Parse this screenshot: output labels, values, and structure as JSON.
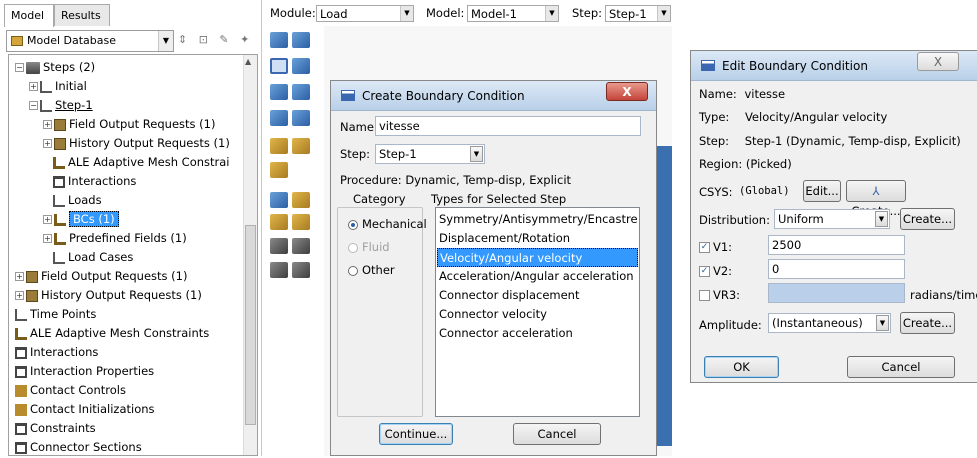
{
  "left_panel": {
    "tabs": [
      "Model",
      "Results"
    ],
    "database_selector": "Model Database",
    "tree": [
      {
        "label": "Steps (2)",
        "expander": "⊟",
        "icon": "steps"
      },
      {
        "label": "Initial",
        "expander": "⊞",
        "icon": "step"
      },
      {
        "label": "Step-1",
        "expander": "⊟",
        "icon": "step"
      },
      {
        "label": "Field Output Requests (1)",
        "expander": "⊞",
        "icon": "output"
      },
      {
        "label": "History Output Requests (1)",
        "expander": "⊞",
        "icon": "output"
      },
      {
        "label": "ALE Adaptive Mesh Constrai",
        "expander": "",
        "icon": "ale"
      },
      {
        "label": "Interactions",
        "expander": "",
        "icon": "interactions"
      },
      {
        "label": "Loads",
        "expander": "",
        "icon": "load"
      },
      {
        "label": "BCs (1)",
        "expander": "⊞",
        "icon": "bc"
      },
      {
        "label": "Predefined Fields (1)",
        "expander": "⊞",
        "icon": "bc"
      },
      {
        "label": "Load Cases",
        "expander": "",
        "icon": "load"
      },
      {
        "label": "Field Output Requests (1)",
        "expander": "⊞",
        "icon": "output"
      },
      {
        "label": "History Output Requests (1)",
        "expander": "⊞",
        "icon": "output"
      },
      {
        "label": "Time Points",
        "expander": "",
        "icon": "time"
      },
      {
        "label": "ALE Adaptive Mesh Constraints",
        "expander": "",
        "icon": "ale"
      },
      {
        "label": "Interactions",
        "expander": "",
        "icon": "interactions"
      },
      {
        "label": "Interaction Properties",
        "expander": "",
        "icon": "interactions"
      },
      {
        "label": "Contact Controls",
        "expander": "",
        "icon": "contact"
      },
      {
        "label": "Contact Initializations",
        "expander": "",
        "icon": "contact"
      },
      {
        "label": "Constraints",
        "expander": "",
        "icon": "constraint"
      },
      {
        "label": "Connector Sections",
        "expander": "",
        "icon": "connector"
      }
    ]
  },
  "toolbar": {
    "module_label": "Module:",
    "module_value": "Load",
    "model_label": "Model:",
    "model_value": "Model-1",
    "step_label": "Step:",
    "step_value": "Step-1"
  },
  "create_bc_dialog": {
    "title": "Create Boundary Condition",
    "name_label": "Name:",
    "name_value": "vitesse",
    "step_label": "Step:",
    "step_value": "Step-1",
    "procedure_label": "Procedure:",
    "procedure_value": "Dynamic, Temp-disp, Explicit",
    "category_label": "Category",
    "categories": [
      {
        "label": "Mechanical",
        "selected": true,
        "enabled": true
      },
      {
        "label": "Fluid",
        "selected": false,
        "enabled": false
      },
      {
        "label": "Other",
        "selected": false,
        "enabled": true
      }
    ],
    "types_label": "Types for Selected Step",
    "types": [
      "Symmetry/Antisymmetry/Encastre",
      "Displacement/Rotation",
      "Velocity/Angular velocity",
      "Acceleration/Angular acceleration",
      "Connector displacement",
      "Connector velocity",
      "Connector acceleration"
    ],
    "selected_type_index": 2,
    "continue_label": "Continue...",
    "cancel_label": "Cancel",
    "close_glyph": "X"
  },
  "edit_bc_dialog": {
    "title": "Edit Boundary Condition",
    "name_label": "Name:",
    "name_value": "vitesse",
    "type_label": "Type:",
    "type_value": "Velocity/Angular velocity",
    "step_label": "Step:",
    "step_value": "Step-1 (Dynamic, Temp-disp, Explicit)",
    "region_label": "Region:",
    "region_value": "(Picked)",
    "csys_label": "CSYS:",
    "csys_value": "(Global)",
    "csys_edit_label": "Edit...",
    "csys_create_label": "Create...",
    "distribution_label": "Distribution:",
    "distribution_value": "Uniform",
    "distribution_create_label": "Create...",
    "v1_label": "V1:",
    "v1_value": "2500",
    "v1_checked": true,
    "v2_label": "V2:",
    "v2_value": "0",
    "v2_checked": true,
    "vr3_label": "VR3:",
    "vr3_value": "",
    "vr3_checked": false,
    "vr3_unit": "radians/time",
    "amplitude_label": "Amplitude:",
    "amplitude_value": "(Instantaneous)",
    "amplitude_create_label": "Create...",
    "ok_label": "OK",
    "cancel_label": "Cancel",
    "close_glyph": "X"
  }
}
